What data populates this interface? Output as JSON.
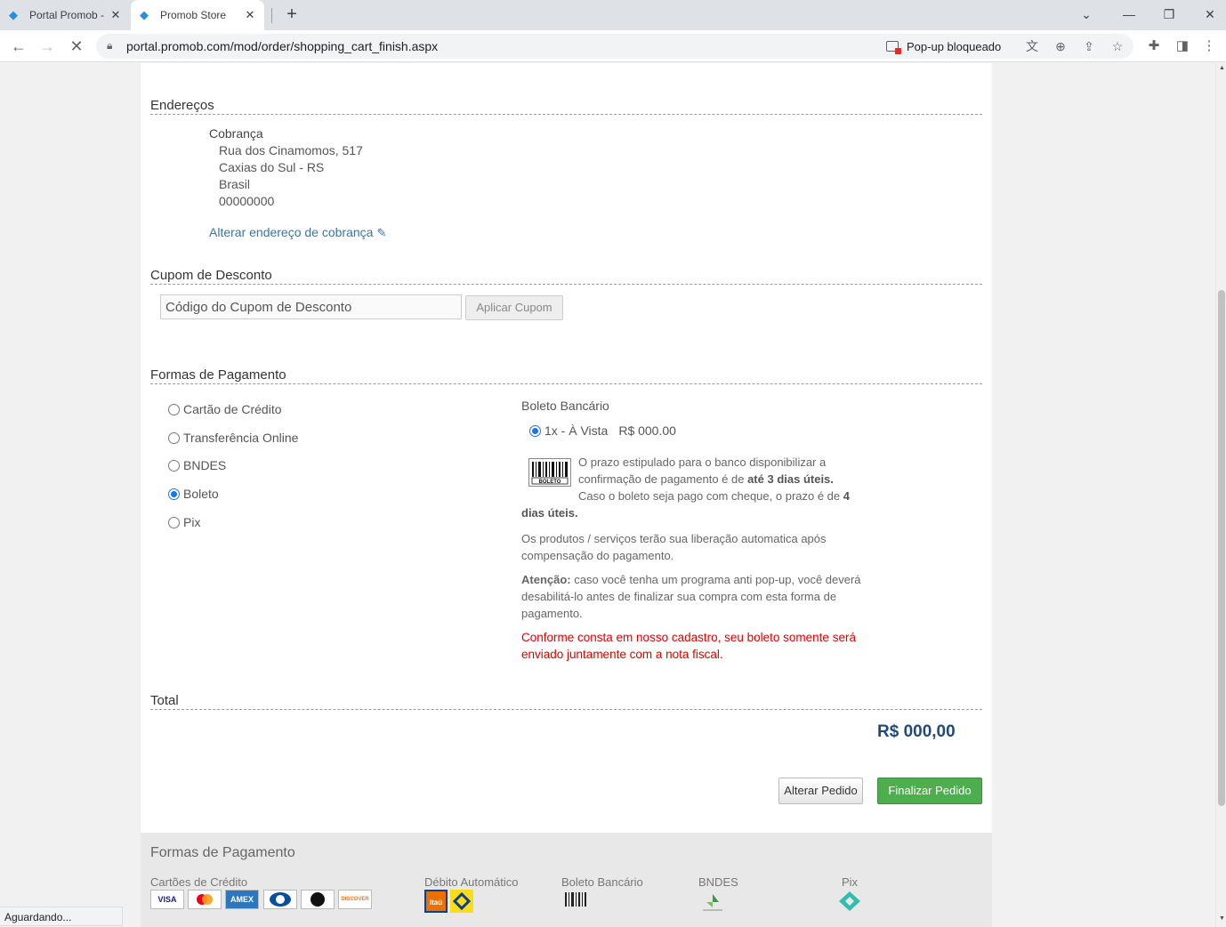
{
  "browser": {
    "tabs": [
      {
        "title": "Portal Promob - ",
        "active": false
      },
      {
        "title": "Promob Store",
        "active": true
      }
    ],
    "url": "portal.promob.com/mod/order/shopping_cart_finish.aspx",
    "popup_blocked_label": "Pop-up bloqueado",
    "status_text": "Aguardando..."
  },
  "addresses": {
    "section_title": "Endereços",
    "billing": {
      "heading": "Cobrança",
      "street": "Rua dos Cinamomos, 517",
      "city": "Caxias do Sul - RS",
      "country": "Brasil",
      "zip": "00000000"
    },
    "change_link": "Alterar endereço de cobrança"
  },
  "coupon": {
    "section_title": "Cupom de Desconto",
    "placeholder": "Código do Cupom de Desconto",
    "apply_label": "Aplicar Cupom"
  },
  "payment": {
    "section_title": "Formas de Pagamento",
    "options": [
      {
        "label": "Cartão de Crédito",
        "selected": false
      },
      {
        "label": "Transferência Online",
        "selected": false
      },
      {
        "label": "BNDES",
        "selected": false
      },
      {
        "label": "Boleto",
        "selected": true
      },
      {
        "label": "Pix",
        "selected": false
      }
    ],
    "boleto": {
      "title": "Boleto Bancário",
      "installment": "1x - À Vista",
      "installment_price": "R$ 000.00",
      "barcode_label": "BOLETO",
      "text_1": "O prazo estipulado para o banco disponibilizar a",
      "text_2a": "confirmação de pagamento é de ",
      "text_2b": "até 3 dias úteis.",
      "text_3a": "Caso o boleto seja pago com cheque, o prazo é de ",
      "text_3b": "4",
      "text_4": "dias úteis.",
      "release_note": "Os produtos / serviços terão sua liberação automatica após compensação do pagamento.",
      "warning_label": "Atenção:",
      "warning_text": " caso você tenha um programa anti pop-up, você deverá desabilitá-lo antes de finalizar sua compra com esta forma de pagamento.",
      "notice": "Conforme consta em nosso cadastro, seu boleto somente será enviado juntamente com a nota fiscal."
    }
  },
  "total": {
    "section_title": "Total",
    "value": "R$ 000,00"
  },
  "actions": {
    "alter_label": "Alterar Pedido",
    "finish_label": "Finalizar Pedido"
  },
  "footer": {
    "title": "Formas de Pagamento",
    "credit_cards_label": "Cartões de Crédito",
    "cards": [
      "VISA",
      "",
      "AMEX",
      "",
      "elo",
      "DISCOVER"
    ],
    "debit_label": "Débito Automático",
    "debit_banks": [
      "Itaú",
      ""
    ],
    "boleto_label": "Boleto Bancário",
    "bndes_label": "BNDES",
    "pix_label": "Pix"
  },
  "colors": {
    "link": "#3b74a8",
    "finish_button": "#4cae4c",
    "notice_red": "#e00000",
    "total": "#1f4a7a"
  }
}
